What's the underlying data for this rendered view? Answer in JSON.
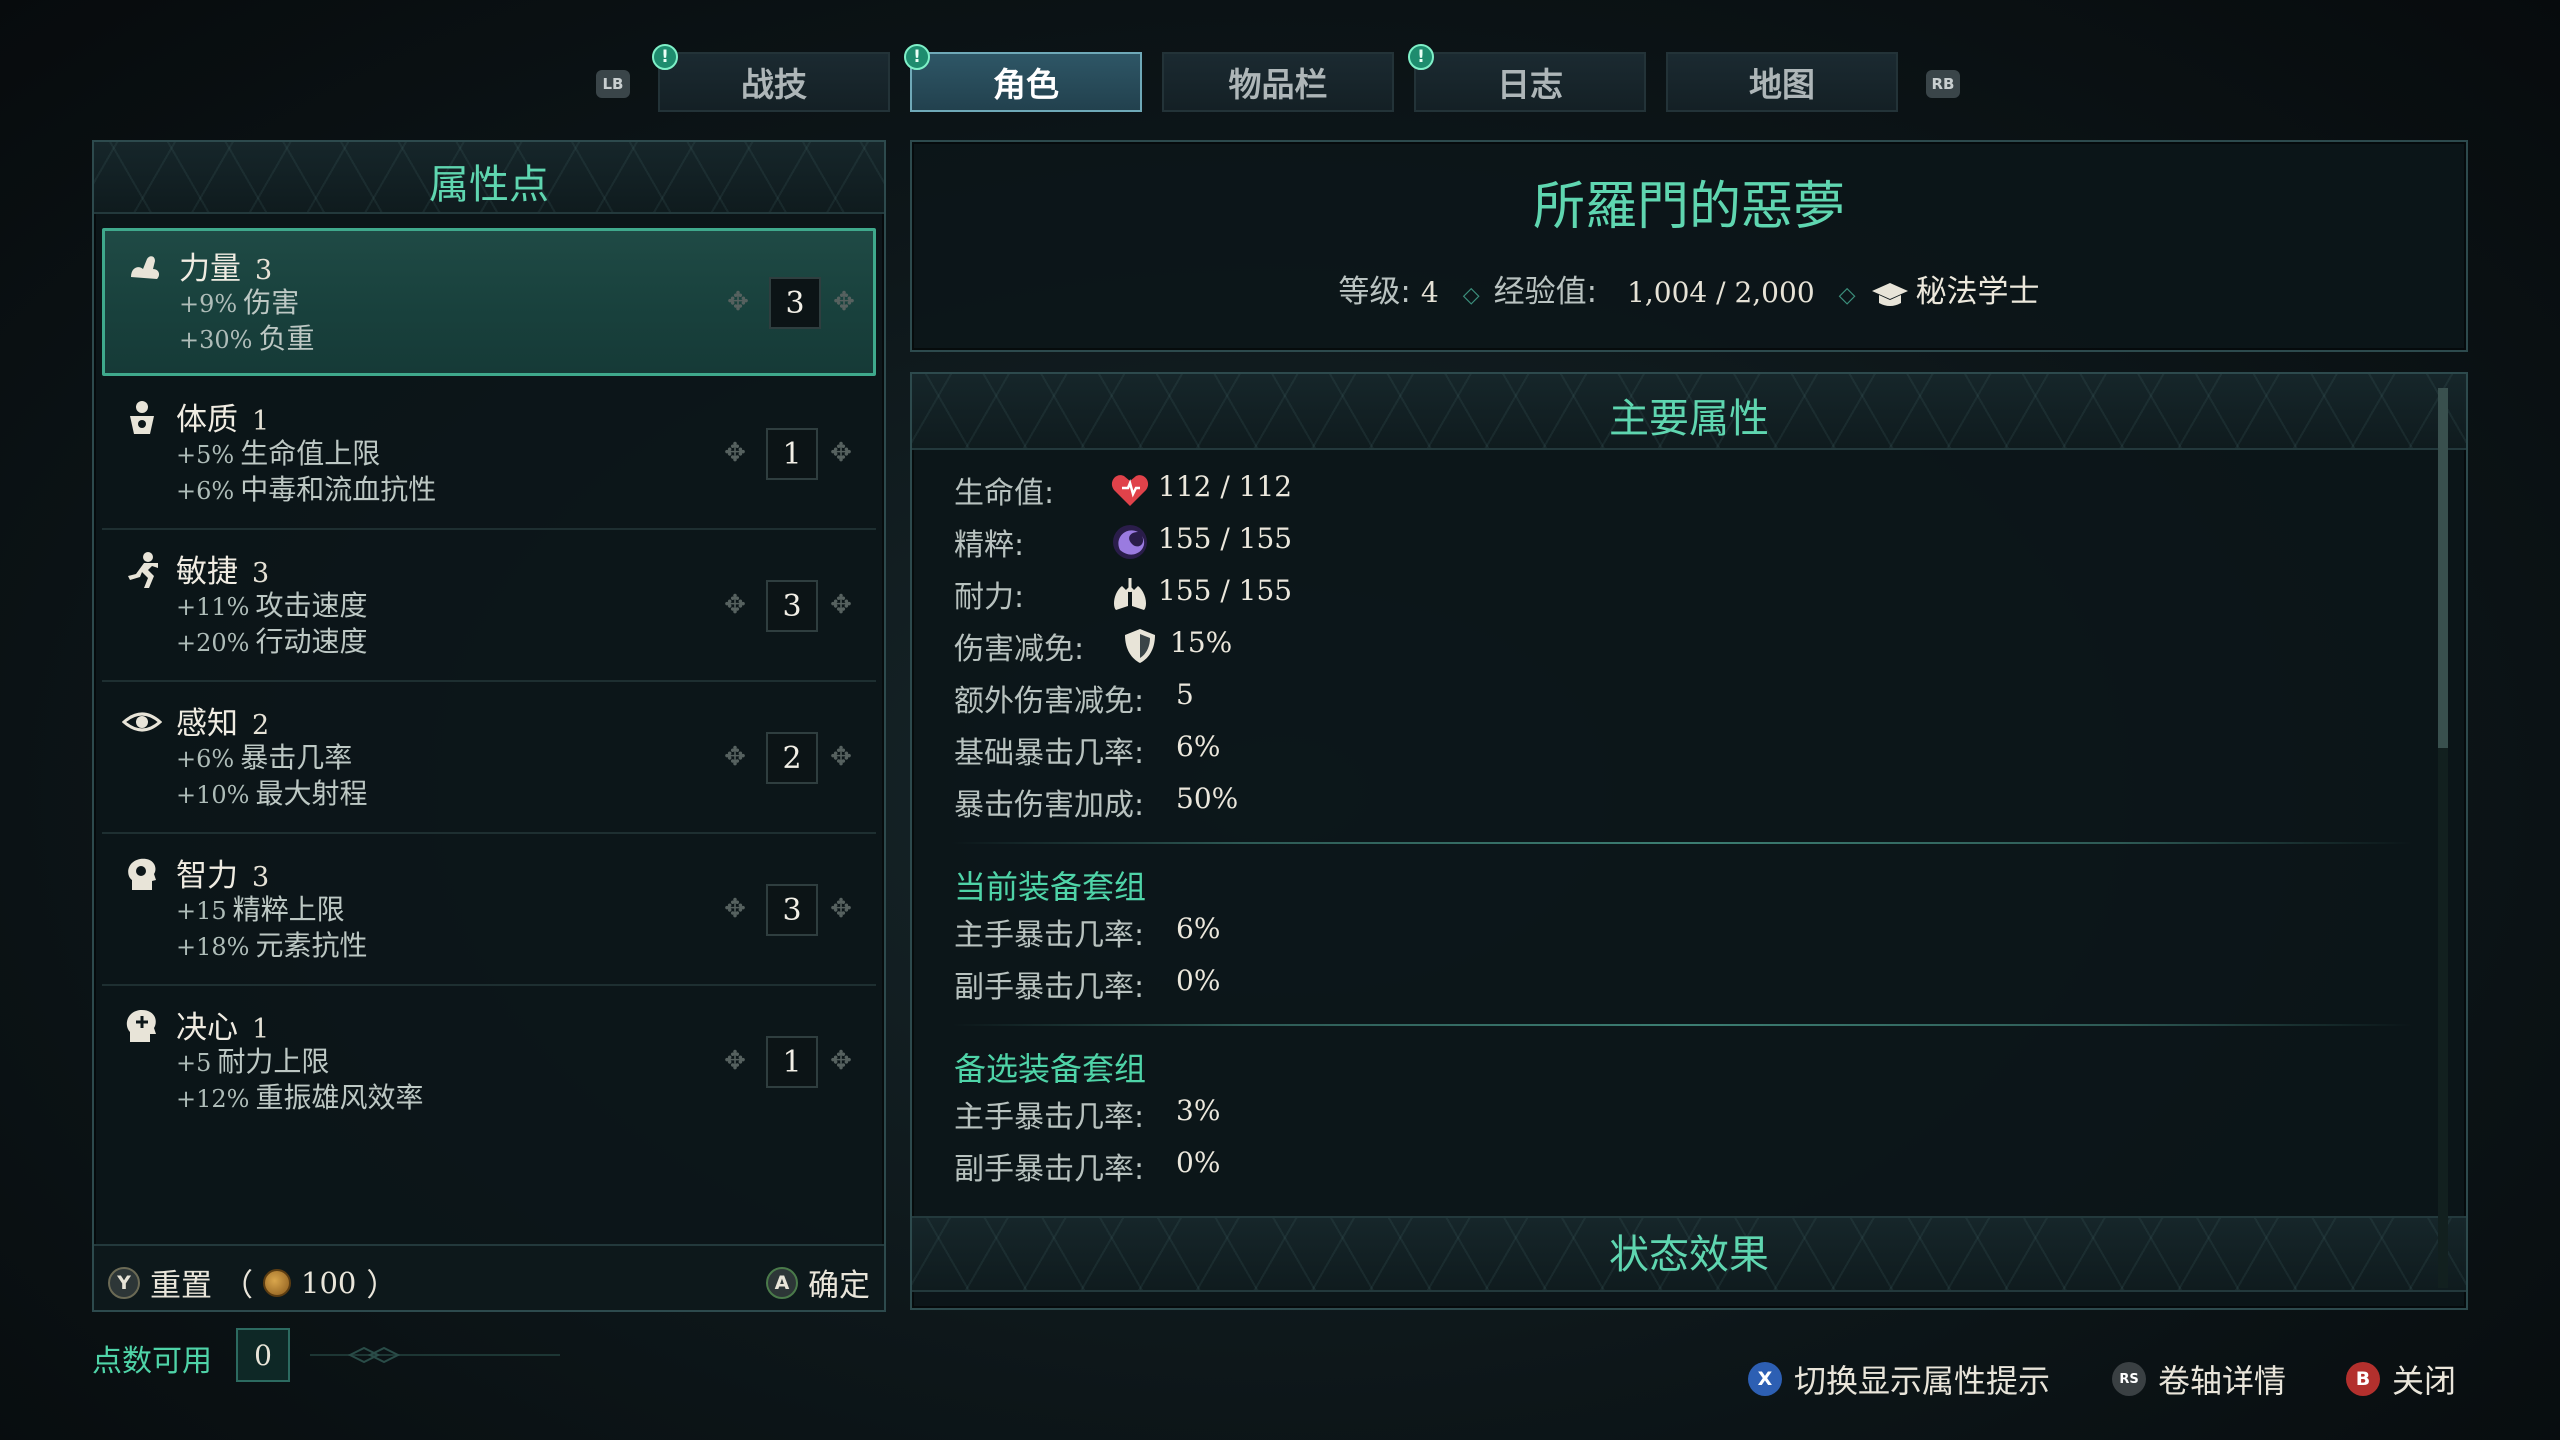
{
  "tabs": {
    "left_bumper": "LB",
    "right_bumper": "RB",
    "alert_symbol": "!",
    "items": [
      {
        "label": "战技",
        "alert": true,
        "active": false
      },
      {
        "label": "角色",
        "alert": true,
        "active": true
      },
      {
        "label": "物品栏",
        "alert": false,
        "active": false
      },
      {
        "label": "日志",
        "alert": true,
        "active": false
      },
      {
        "label": "地图",
        "alert": false,
        "active": false
      }
    ]
  },
  "attributes_panel": {
    "title": "属性点",
    "items": [
      {
        "name": "力量",
        "value": "3",
        "icon": "strength-arm-icon",
        "bonuses": [
          {
            "pct": "+9%",
            "text": "伤害"
          },
          {
            "pct": "+30%",
            "text": "负重"
          }
        ],
        "stepper": "3",
        "selected": true
      },
      {
        "name": "体质",
        "value": "1",
        "icon": "constitution-body-icon",
        "bonuses": [
          {
            "pct": "+5%",
            "text": "生命值上限"
          },
          {
            "pct": "+6%",
            "text": "中毒和流血抗性"
          }
        ],
        "stepper": "1",
        "selected": false
      },
      {
        "name": "敏捷",
        "value": "3",
        "icon": "dexterity-runner-icon",
        "bonuses": [
          {
            "pct": "+11%",
            "text": "攻击速度"
          },
          {
            "pct": "+20%",
            "text": "行动速度"
          }
        ],
        "stepper": "3",
        "selected": false
      },
      {
        "name": "感知",
        "value": "2",
        "icon": "perception-eye-icon",
        "bonuses": [
          {
            "pct": "+6%",
            "text": "暴击几率"
          },
          {
            "pct": "+10%",
            "text": "最大射程"
          }
        ],
        "stepper": "2",
        "selected": false
      },
      {
        "name": "智力",
        "value": "3",
        "icon": "intelligence-head-icon",
        "bonuses": [
          {
            "pct": "+15",
            "text": "精粹上限"
          },
          {
            "pct": "+18%",
            "text": "元素抗性"
          }
        ],
        "stepper": "3",
        "selected": false
      },
      {
        "name": "决心",
        "value": "1",
        "icon": "resolve-head-icon",
        "bonuses": [
          {
            "pct": "+5",
            "text": "耐力上限"
          },
          {
            "pct": "+12%",
            "text": "重振雄风效率"
          }
        ],
        "stepper": "1",
        "selected": false
      }
    ],
    "footer": {
      "reset_button_glyph": "Y",
      "reset_label": "重置",
      "reset_cost_open": "（",
      "reset_cost": "100",
      "reset_cost_close": "）",
      "confirm_button_glyph": "A",
      "confirm_label": "确定"
    }
  },
  "points_available": {
    "label": "点数可用",
    "value": "0"
  },
  "character": {
    "name": "所羅門的惡夢",
    "level_label": "等级:",
    "level": "4",
    "xp_label": "经验值:",
    "xp": "1,004 / 2,000",
    "class_name": "秘法学士",
    "class_icon": "mortarboard-icon"
  },
  "main_stats": {
    "title": "主要属性",
    "stats": [
      {
        "label": "生命值:",
        "value": "112 / 112",
        "icon": "heart-icon"
      },
      {
        "label": "精粹:",
        "value": "155 / 155",
        "icon": "essence-swirl-icon"
      },
      {
        "label": "耐力:",
        "value": "155 / 155",
        "icon": "lungs-icon"
      },
      {
        "label": "伤害减免:",
        "value": "15%",
        "icon": "shield-icon"
      },
      {
        "label": "额外伤害减免:",
        "value": "5"
      },
      {
        "label": "基础暴击几率:",
        "value": "6%"
      },
      {
        "label": "暴击伤害加成:",
        "value": "50%"
      }
    ],
    "current_set": {
      "title": "当前装备套组",
      "stats": [
        {
          "label": "主手暴击几率:",
          "value": "6%"
        },
        {
          "label": "副手暴击几率:",
          "value": "0%"
        }
      ]
    },
    "alternate_set": {
      "title": "备选装备套组",
      "stats": [
        {
          "label": "主手暴击几率:",
          "value": "3%"
        },
        {
          "label": "副手暴击几率:",
          "value": "0%"
        }
      ]
    },
    "status_effects_title": "状态效果"
  },
  "hints": [
    {
      "glyph": "X",
      "label": "切换显示属性提示",
      "color": "#2d5fb3"
    },
    {
      "glyph": "RS",
      "label": "卷轴详情",
      "color": "#3a4043"
    },
    {
      "glyph": "B",
      "label": "关闭",
      "color": "#b3302d"
    }
  ],
  "colors": {
    "accent": "#5fd6b0",
    "section": "#4fd4a8",
    "active_tab": "#2e5666"
  }
}
